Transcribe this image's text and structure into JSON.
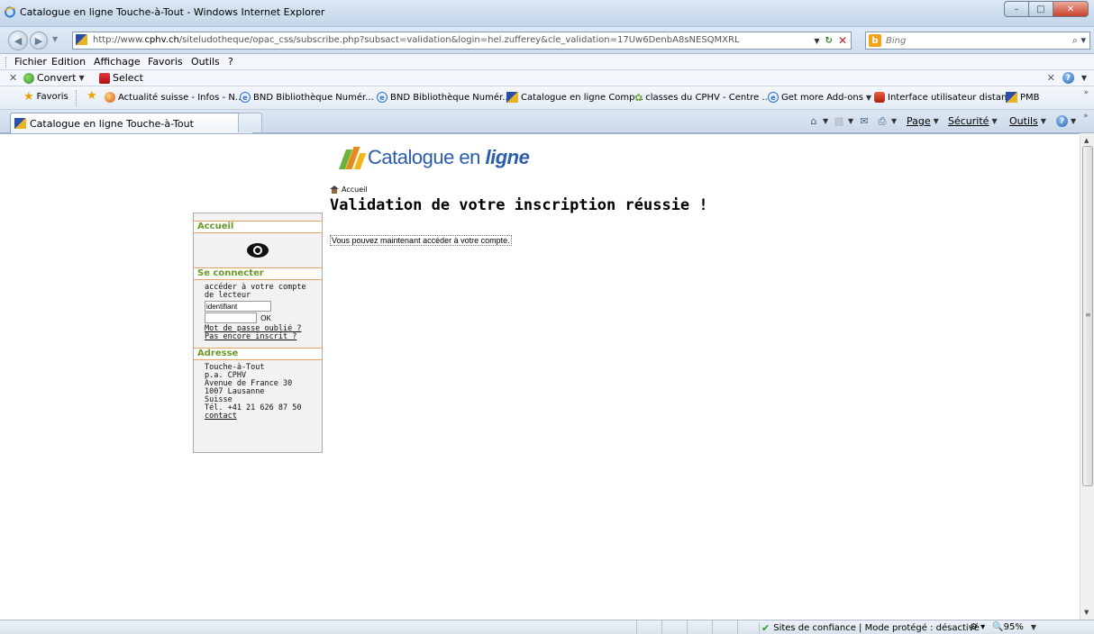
{
  "window": {
    "title": "Catalogue en ligne Touche-à-Tout - Windows Internet Explorer"
  },
  "address_bar": {
    "url_prefix": "http://www.",
    "url_domain": "cphv.ch",
    "url_path": "/siteludotheque/opac_css/subscribe.php?subsact=validation&login=hel.zufferey&cle_validation=17Uw6DenbA8sNESQMXRL",
    "search_placeholder": "Bing",
    "search_provider": "b"
  },
  "menu": {
    "items": [
      "Fichier",
      "Edition",
      "Affichage",
      "Favoris",
      "Outils",
      "?"
    ]
  },
  "toolbar": {
    "convert_label": "Convert",
    "select_label": "Select"
  },
  "favorites": {
    "label": "Favoris",
    "items": [
      "Actualité suisse - Infos - N...",
      "BND  Bibliothèque Numér...",
      "BND  Bibliothèque Numér...",
      "Catalogue en ligne Comp...",
      "classes du CPHV - Centre ...",
      "Get more Add-ons",
      "Interface utilisateur distan...",
      "PMB"
    ]
  },
  "tab": {
    "title": "Catalogue en ligne Touche-à-Tout"
  },
  "command_bar": {
    "page": "Page",
    "security": "Sécurité",
    "tools": "Outils"
  },
  "page": {
    "logo_text_1": "Catalogue en ",
    "logo_text_2": "ligne",
    "breadcrumb": "Accueil",
    "title": "Validation de votre inscription réussie !",
    "message": "Vous pouvez maintenant accéder à votre compte."
  },
  "sidebar": {
    "home_heading": "Accueil",
    "login_heading": "Se connecter",
    "login_text": "accéder à votre compte de lecteur",
    "login_value": "identifiant",
    "ok_label": "OK",
    "forgot_password": "Mot de passe oublié ?",
    "not_registered": "Pas encore inscrit ?",
    "address_heading": "Adresse",
    "address_lines": [
      "Touche-à-Tout",
      "p.a. CPHV",
      "Avenue de France 30",
      "1007 Lausanne",
      "Suisse",
      "Tél. +41 21 626 87 50"
    ],
    "contact_link": "contact"
  },
  "status": {
    "zone": "Sites de confiance | Mode protégé : désactivé",
    "zoom": "95%"
  }
}
